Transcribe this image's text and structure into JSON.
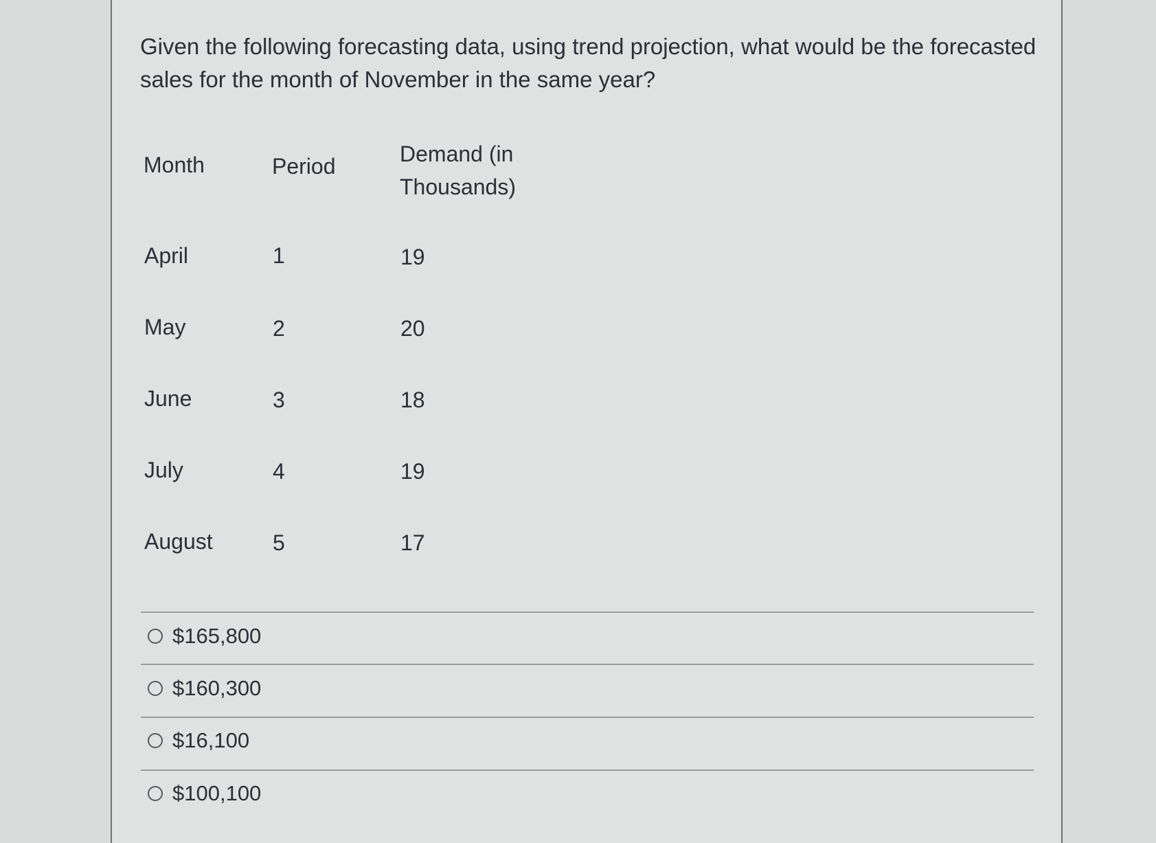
{
  "question": {
    "text_line1": "Given the following forecasting data, using trend projection, what would be the forecasted",
    "text_line2": "sales for the month of November in the same year?"
  },
  "table": {
    "headers": {
      "month": "Month",
      "period": "Period",
      "demand_line1": "Demand (in",
      "demand_line2": "Thousands)"
    },
    "rows": [
      {
        "month": "April",
        "period": "1",
        "demand": "19"
      },
      {
        "month": "May",
        "period": "2",
        "demand": "20"
      },
      {
        "month": "June",
        "period": "3",
        "demand": "18"
      },
      {
        "month": "July",
        "period": "4",
        "demand": "19"
      },
      {
        "month": "August",
        "period": "5",
        "demand": "17"
      }
    ]
  },
  "answers": {
    "options": [
      {
        "label": "$165,800",
        "selected": false
      },
      {
        "label": "$160,300",
        "selected": false
      },
      {
        "label": "$16,100",
        "selected": false
      },
      {
        "label": "$100,100",
        "selected": false
      }
    ]
  },
  "colors": {
    "background": "#dfe2e1",
    "text": "#2b3035",
    "border": "#6d7176",
    "divider": "#9a9ea1"
  }
}
